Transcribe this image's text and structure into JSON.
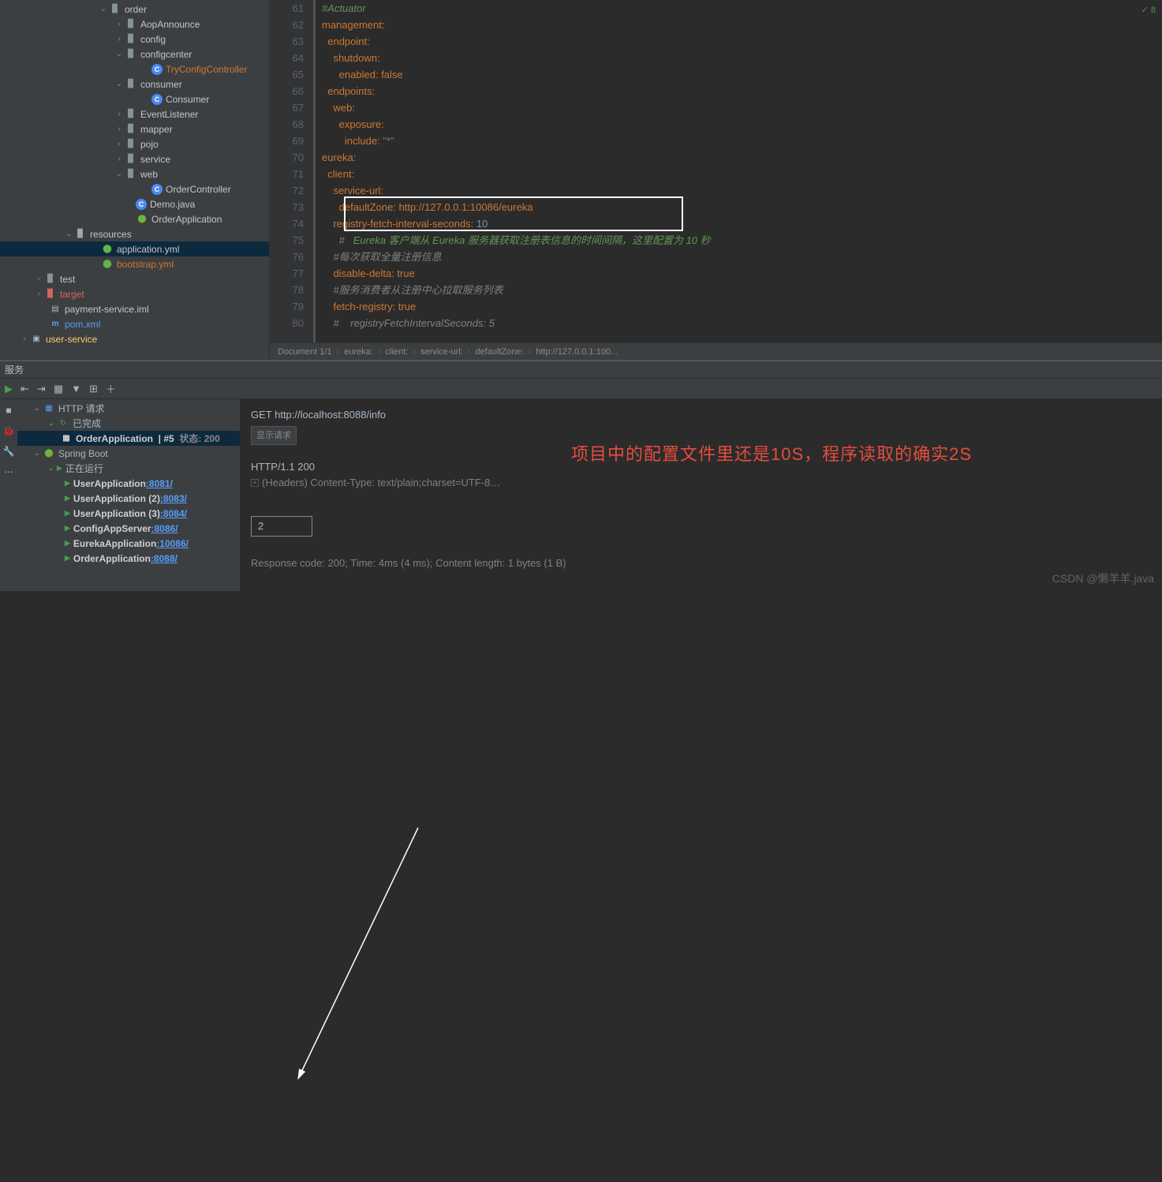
{
  "sidebar": {
    "tree": [
      {
        "indent": 124,
        "tw": "⌄",
        "icon": "folder",
        "label": "order"
      },
      {
        "indent": 144,
        "tw": "›",
        "icon": "folder",
        "label": "AopAnnounce"
      },
      {
        "indent": 144,
        "tw": "›",
        "icon": "folder",
        "label": "config"
      },
      {
        "indent": 144,
        "tw": "⌄",
        "icon": "folder",
        "label": "configcenter"
      },
      {
        "indent": 178,
        "tw": "",
        "icon": "class",
        "label": "TryConfigController",
        "cls": "red-txt"
      },
      {
        "indent": 144,
        "tw": "⌄",
        "icon": "folder",
        "label": "consumer"
      },
      {
        "indent": 178,
        "tw": "",
        "icon": "class",
        "label": "Consumer"
      },
      {
        "indent": 144,
        "tw": "›",
        "icon": "folder",
        "label": "EventListener"
      },
      {
        "indent": 144,
        "tw": "›",
        "icon": "folder",
        "label": "mapper"
      },
      {
        "indent": 144,
        "tw": "›",
        "icon": "folder",
        "label": "pojo"
      },
      {
        "indent": 144,
        "tw": "›",
        "icon": "folder",
        "label": "service"
      },
      {
        "indent": 144,
        "tw": "⌄",
        "icon": "folder",
        "label": "web"
      },
      {
        "indent": 178,
        "tw": "",
        "icon": "class",
        "label": "OrderController"
      },
      {
        "indent": 158,
        "tw": "",
        "icon": "class",
        "label": "Demo.java",
        "iconVariant": "J"
      },
      {
        "indent": 158,
        "tw": "",
        "icon": "spring",
        "label": "OrderApplication"
      },
      {
        "indent": 80,
        "tw": "⌄",
        "icon": "res-folder",
        "label": "resources"
      },
      {
        "indent": 114,
        "tw": "",
        "icon": "yml",
        "label": "application.yml",
        "sel": true
      },
      {
        "indent": 114,
        "tw": "",
        "icon": "yml",
        "label": "bootstrap.yml",
        "cls": "red-txt"
      },
      {
        "indent": 42,
        "tw": "›",
        "icon": "folder",
        "label": "test"
      },
      {
        "indent": 42,
        "tw": "›",
        "icon": "folder-orange",
        "label": "target",
        "cls": "folder-orange"
      },
      {
        "indent": 48,
        "tw": "",
        "icon": "file",
        "label": "payment-service.iml"
      },
      {
        "indent": 48,
        "tw": "",
        "icon": "maven",
        "label": "pom.xml",
        "cls": "blue-txt"
      },
      {
        "indent": 24,
        "tw": "›",
        "icon": "module",
        "label": "user-service",
        "cls": "yellow-txt"
      }
    ]
  },
  "editor": {
    "topBadge": "8",
    "startLine": 61,
    "lines": [
      {
        "t": "#Actuator",
        "cls": "k-cmt-hl"
      },
      {
        "t": "management:",
        "k": true,
        "i": 0
      },
      {
        "t": "endpoint:",
        "k": true,
        "i": 1
      },
      {
        "t": "shutdown:",
        "k": true,
        "i": 2
      },
      {
        "t": "enabled: false",
        "kv": [
          "enabled",
          "false"
        ],
        "i": 3
      },
      {
        "t": "endpoints:",
        "k": true,
        "i": 1
      },
      {
        "t": "web:",
        "k": true,
        "i": 2
      },
      {
        "t": "exposure:",
        "k": true,
        "i": 3
      },
      {
        "t": "include: \"*\"",
        "kv": [
          "include",
          "\"*\""
        ],
        "i": 4,
        "strval": true
      },
      {
        "t": "eureka:",
        "k": true,
        "i": 0
      },
      {
        "t": "client:",
        "k": true,
        "i": 1
      },
      {
        "t": "service-url:",
        "k": true,
        "i": 2
      },
      {
        "t": "defaultZone: http://127.0.0.1:10086/eureka",
        "kv": [
          "defaultZone",
          "http://127.0.0.1:10086/eureka"
        ],
        "i": 3
      },
      {
        "t": "registry-fetch-interval-seconds: 10",
        "kv": [
          "registry-fetch-interval-seconds",
          "10"
        ],
        "i": 2,
        "numval": true,
        "hl": true
      },
      {
        "t": "#   Eureka 客户端从 Eureka 服务器获取注册表信息的时间间隔，这里配置为 10 秒",
        "cls": "k-cmt-hl",
        "i": 3
      },
      {
        "t": "#每次获取全量注册信息",
        "cls": "k-cmt",
        "i": 2
      },
      {
        "t": "disable-delta: true",
        "kv": [
          "disable-delta",
          "true"
        ],
        "i": 2
      },
      {
        "t": "#服务消费者从注册中心拉取服务列表",
        "cls": "k-cmt",
        "i": 2
      },
      {
        "t": "fetch-registry: true",
        "kv": [
          "fetch-registry",
          "true"
        ],
        "i": 2
      },
      {
        "t": "#    registryFetchIntervalSeconds: 5",
        "cls": "k-cmt",
        "i": 2
      }
    ],
    "breadcrumb": [
      "Document 1/1",
      "eureka:",
      "client:",
      "service-url:",
      "defaultZone:",
      "http://127.0.0.1:100..."
    ]
  },
  "services": {
    "tabTitle": "服务",
    "httpReqLabel": "HTTP 请求",
    "doneLabel": "已完成",
    "orderAppRow": {
      "name": "OrderApplication",
      "suffix": "|  #5",
      "status": "状态: 200"
    },
    "springBoot": "Spring Boot",
    "runningLabel": "正在运行",
    "apps": [
      {
        "name": "UserApplication",
        "port": ":8081/"
      },
      {
        "name": "UserApplication (2)",
        "port": ":8083/"
      },
      {
        "name": "UserApplication (3)",
        "port": ":8084/"
      },
      {
        "name": "ConfigAppServer",
        "port": ":8086/"
      },
      {
        "name": "EurekaApplication",
        "port": ":10086/"
      },
      {
        "name": "OrderApplication",
        "port": ":8088/"
      }
    ]
  },
  "http": {
    "request": "GET http://localhost:8088/info",
    "showReq": "显示请求",
    "statusLine": "HTTP/1.1 200 ",
    "headers": "(Headers)   Content-Type: text/plain;charset=UTF-8…",
    "body": "2",
    "response": "Response code: 200; Time: 4ms (4 ms); Content length: 1 bytes (1 B)"
  },
  "annotation": "项目中的配置文件里还是10S，程序读取的确实2S",
  "watermark": "CSDN @懒羊羊.java"
}
